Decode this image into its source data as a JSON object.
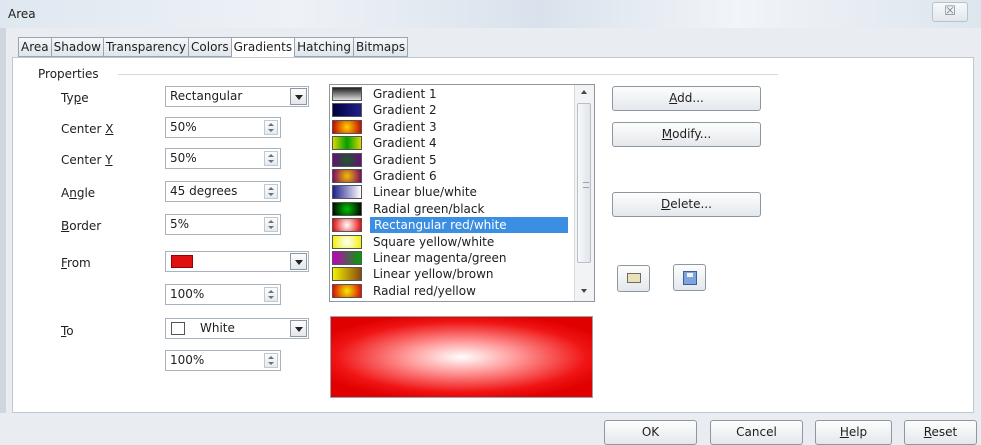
{
  "window": {
    "title": "Area",
    "close_glyph": "☒"
  },
  "tabs": [
    {
      "label": "Area"
    },
    {
      "label": "Shadow"
    },
    {
      "label": "Transparency"
    },
    {
      "label": "Colors"
    },
    {
      "label": "Gradients"
    },
    {
      "label": "Hatching"
    },
    {
      "label": "Bitmaps"
    }
  ],
  "active_tab": "Gradients",
  "properties": {
    "group_label": "Properties",
    "type": {
      "label_pre": "Ty",
      "label_u": "p",
      "label_post": "e",
      "value": "Rectangular"
    },
    "center_x": {
      "label_pre": "Center ",
      "label_u": "X",
      "value": "50%"
    },
    "center_y": {
      "label_pre": "Center ",
      "label_u": "Y",
      "value": "50%"
    },
    "angle": {
      "label_pre": "A",
      "label_u": "n",
      "label_post": "gle",
      "value": "45 degrees"
    },
    "border": {
      "label_u": "B",
      "label_post": "order",
      "value": "5%"
    },
    "from": {
      "label_u": "F",
      "label_post": "rom",
      "color": "#e01010",
      "intensity": "100%"
    },
    "to": {
      "label_u": "T",
      "label_post": "o",
      "color_name": "White",
      "color": "#ffffff",
      "intensity": "100%"
    }
  },
  "gradient_list": {
    "items": [
      {
        "name": "Gradient 1",
        "swatch": "linear-gradient(to bottom, #222, #ddd)"
      },
      {
        "name": "Gradient 2",
        "swatch": "linear-gradient(to right, #000040, #20208a)"
      },
      {
        "name": "Gradient 3",
        "swatch": "radial-gradient(circle, #ffd200, #c00000)"
      },
      {
        "name": "Gradient 4",
        "swatch": "linear-gradient(to right, #d8d800, #00a000, #d8d800)"
      },
      {
        "name": "Gradient 5",
        "swatch": "radial-gradient(circle, #1a5a2a, #6a0a7a)"
      },
      {
        "name": "Gradient 6",
        "swatch": "radial-gradient(circle, #f0c000, #7a006a)"
      },
      {
        "name": "Linear blue/white",
        "swatch": "linear-gradient(to right, #202090, #ffffff)"
      },
      {
        "name": "Radial green/black",
        "swatch": "radial-gradient(circle, #00c000, #000000)"
      },
      {
        "name": "Rectangular red/white",
        "swatch": "radial-gradient(circle, #ffffff, #e00000)"
      },
      {
        "name": "Square yellow/white",
        "swatch": "radial-gradient(circle, #ffffff, #f0f000)"
      },
      {
        "name": "Linear magenta/green",
        "swatch": "linear-gradient(to right, #c000c0, #00a000)"
      },
      {
        "name": "Linear yellow/brown",
        "swatch": "linear-gradient(to right, #f0f000, #8a4a10)"
      },
      {
        "name": "Radial red/yellow",
        "swatch": "radial-gradient(circle, #f0f000, #e00000)"
      }
    ],
    "selected_index": 8
  },
  "preview": {
    "description_color_from": "#e00000",
    "description_color_to": "#ffffff"
  },
  "buttons": {
    "add": {
      "u": "A",
      "rest": "dd..."
    },
    "modify": {
      "u": "M",
      "rest": "odify..."
    },
    "delete": {
      "u": "D",
      "rest": "elete..."
    },
    "load_icon": "folder-icon",
    "save_icon": "save-icon"
  },
  "footer": {
    "ok": "OK",
    "cancel": "Cancel",
    "help_u": "H",
    "help_rest": "elp",
    "reset_u": "R",
    "reset_rest": "eset"
  }
}
